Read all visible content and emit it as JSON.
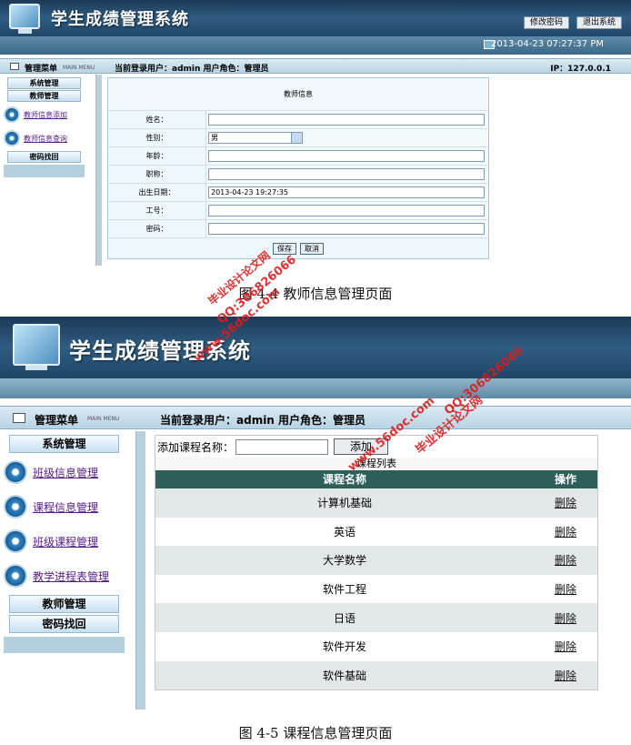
{
  "screen1": {
    "app_title": "学生成绩管理系统",
    "change_password": "修改密码",
    "logout": "退出系统",
    "datetime": "2013-04-23 07:27:37 PM",
    "menu_label": "管理菜单",
    "menu_sub": "MAIN MENU",
    "current_user": "当前登录用户：admin 用户角色：管理员",
    "ip": "IP：127.0.0.1",
    "sidebar": {
      "system_mgmt": "系统管理",
      "teacher_mgmt": "教师管理",
      "teacher_add": "教师信息添加",
      "teacher_query": "教师信息查询",
      "password_recover": "密码找回"
    },
    "form": {
      "title": "教师信息",
      "name_label": "姓名：",
      "gender_label": "性别：",
      "gender_value": "男",
      "age_label": "年龄：",
      "title_label": "职称：",
      "birth_label": "出生日期：",
      "birth_value": "2013-04-23 19:27:35",
      "id_label": "工号：",
      "pwd_label": "密码：",
      "save": "保存",
      "cancel": "取消"
    },
    "caption": "图 4-4 教师信息管理页面"
  },
  "screen2": {
    "app_title": "学生成绩管理系统",
    "menu_label": "管理菜单",
    "menu_sub": "MAIN MENU",
    "current_user": "当前登录用户：admin 用户角色：管理员",
    "sidebar": {
      "system_mgmt": "系统管理",
      "class_info": "班级信息管理",
      "course_info": "课程信息管理",
      "class_course": "班级课程管理",
      "schedule": "教学进程表管理",
      "teacher_mgmt": "教师管理",
      "password_recover": "密码找回"
    },
    "add_label": "添加课程名称：",
    "add_button": "添加",
    "list_title": "课程列表",
    "col_name": "课程名称",
    "col_op": "操作",
    "courses": [
      "计算机基础",
      "英语",
      "大学数学",
      "软件工程",
      "日语",
      "软件开发",
      "软件基础"
    ],
    "delete": "删除",
    "caption": "图 4-5 课程信息管理页面"
  },
  "watermark": {
    "site": "www.56doc.com",
    "qq": "QQ:306826066",
    "brand": "毕业设计论文网"
  }
}
